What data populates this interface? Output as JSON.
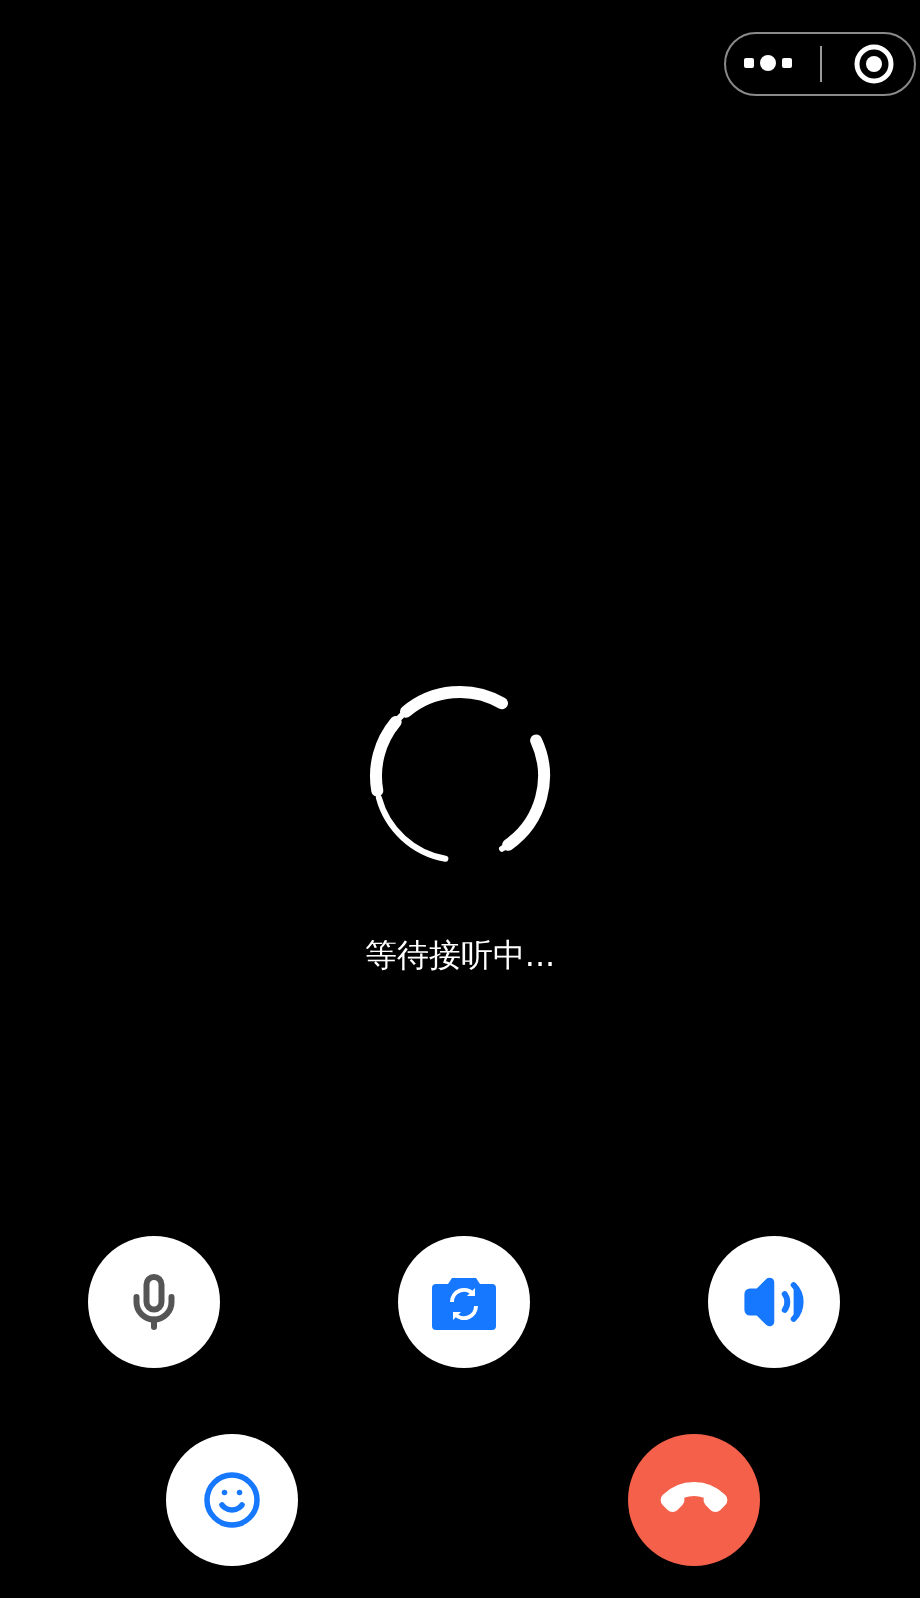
{
  "status": {
    "text": "等待接听中..."
  },
  "rows": [
    {
      "buttons": [
        {
          "kind": "mic",
          "on": false
        },
        {
          "kind": "flip"
        },
        {
          "kind": "speaker",
          "on": true
        }
      ]
    },
    {
      "buttons": [
        {
          "kind": "beauty"
        },
        {
          "kind": "hangup"
        }
      ]
    }
  ]
}
